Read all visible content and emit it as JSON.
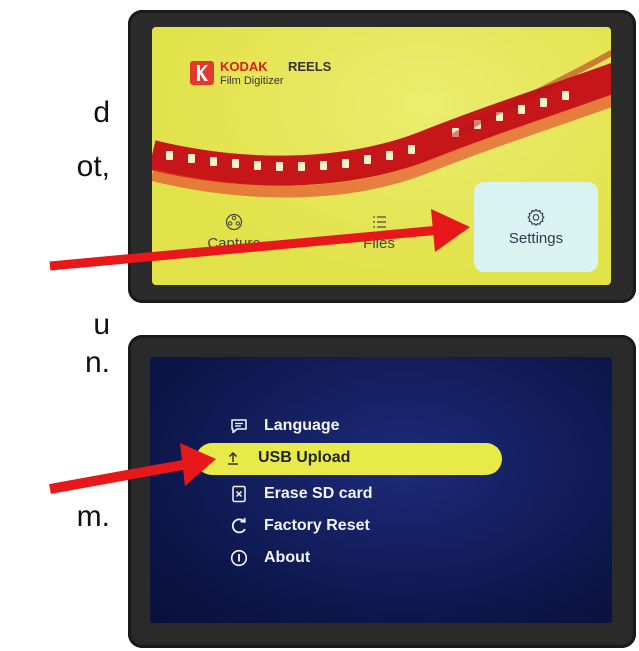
{
  "instructions": [
    {
      "text": "d"
    },
    {
      "text": "ot,"
    },
    {
      "text": "u"
    },
    {
      "text": "n."
    },
    {
      "text": "m."
    }
  ],
  "screen1": {
    "brand_primary": "KODAK",
    "brand_secondary": "REELS",
    "brand_subtitle": "Film Digitizer",
    "menu": [
      {
        "label": "Capture",
        "icon": "reel-icon"
      },
      {
        "label": "Files",
        "icon": "list-icon"
      },
      {
        "label": "Settings",
        "icon": "gear-icon"
      }
    ],
    "selected": "Settings",
    "colors": {
      "screen_bg": "#e2e24a",
      "logo": "#e4382a",
      "selected_bg": "#d9f3f3"
    }
  },
  "screen2": {
    "menu": [
      {
        "label": "Language",
        "icon": "chat-icon"
      },
      {
        "label": "USB Upload",
        "icon": "upload-icon"
      },
      {
        "label": "Erase SD card",
        "icon": "erase-icon"
      },
      {
        "label": "Factory Reset",
        "icon": "reset-icon"
      },
      {
        "label": "About",
        "icon": "info-icon"
      }
    ],
    "selected": "USB Upload",
    "colors": {
      "screen_bg": "#0d164a",
      "highlight": "#e8ea4a"
    }
  },
  "annotation_color": "#e8181a"
}
